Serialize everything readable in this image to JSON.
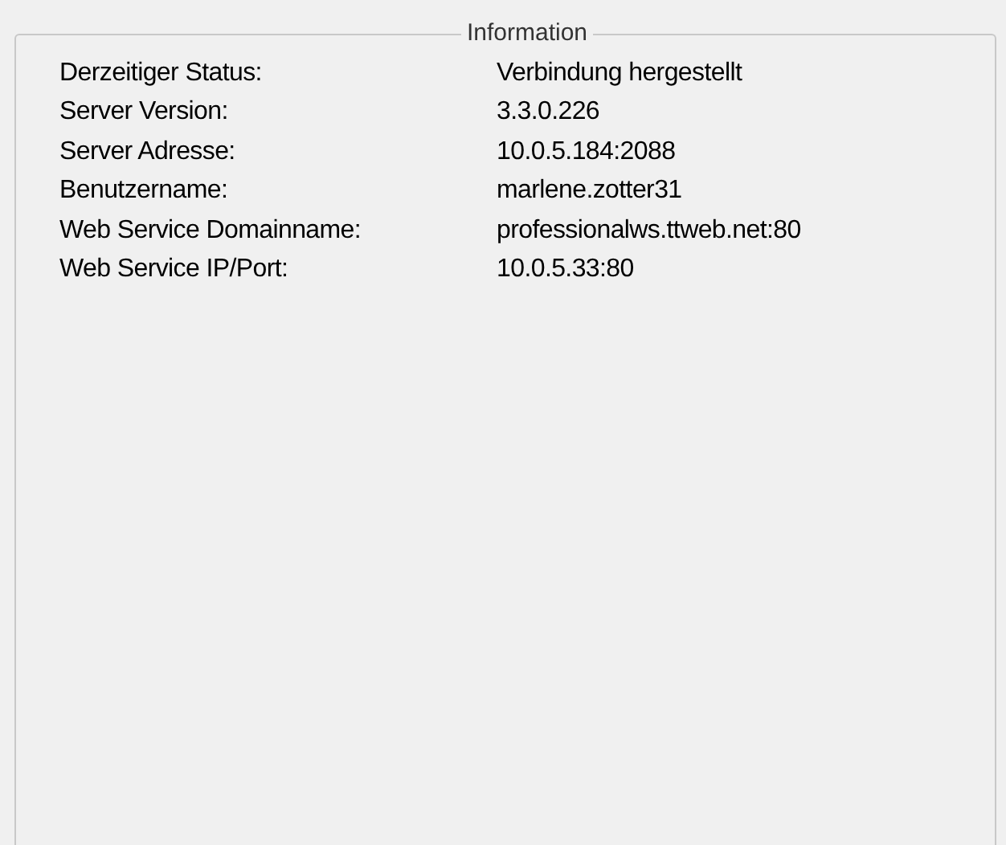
{
  "group": {
    "title": "Information",
    "rows": [
      {
        "label": "Derzeitiger Status:",
        "value": "Verbindung hergestellt"
      },
      {
        "label": "Server Version:",
        "value": "3.3.0.226"
      },
      {
        "label": "Server Adresse:",
        "value": "10.0.5.184:2088"
      },
      {
        "label": "Benutzername:",
        "value": "marlene.zotter31"
      },
      {
        "label": "Web Service Domainname:",
        "value": "professionalws.ttweb.net:80"
      },
      {
        "label": "Web Service IP/Port:",
        "value": "10.0.5.33:80"
      }
    ]
  }
}
